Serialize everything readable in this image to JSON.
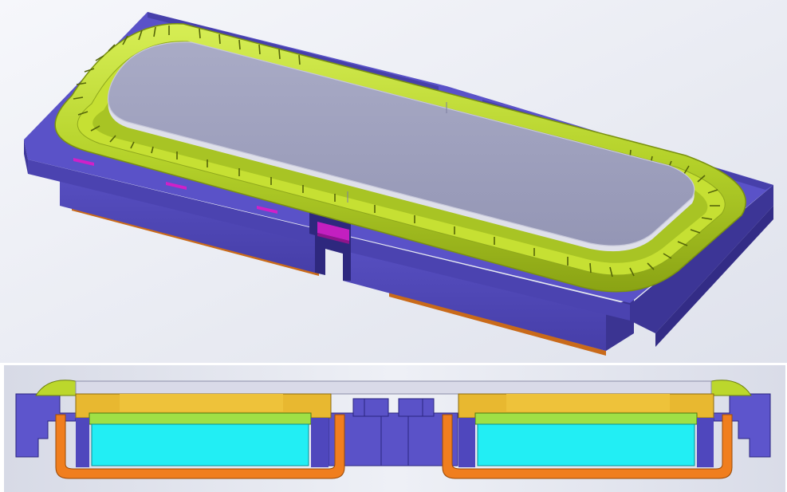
{
  "views": [
    {
      "id": "isometric-view"
    },
    {
      "id": "cross-section-view"
    }
  ],
  "colors": {
    "frame": "#5148b8",
    "frame_dark": "#3d3596",
    "frame_light": "#6a62d4",
    "surround": "#b9d62e",
    "surround_dark": "#8fa81c",
    "diaphragm": "#a6a8c4",
    "diaphragm_edge": "#e4e5ef",
    "terminal": "#d020c8",
    "back_plate": "#c96a1a",
    "voice_coil": "#e8b830",
    "plate": "#9fe046",
    "magnet": "#22eef4",
    "cup": "#f07e1e",
    "background_top": "#f4f5fa",
    "background_bottom": "#dcdfe9"
  },
  "components": [
    "frame",
    "surround",
    "diaphragm",
    "terminal",
    "voice-coil",
    "top-plate",
    "magnet",
    "pot"
  ]
}
